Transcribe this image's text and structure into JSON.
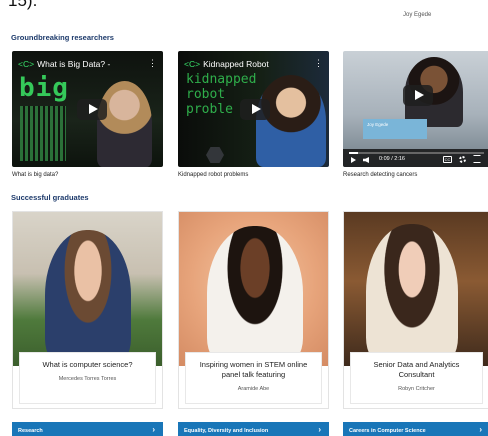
{
  "top": {
    "cut_text": "15).",
    "caption": "Joy Egede"
  },
  "sections": {
    "researchers_title": "Groundbreaking researchers",
    "graduates_title": "Successful graduates"
  },
  "videos": [
    {
      "title_tag": "<C>",
      "title": "What is Big Data? -",
      "caption": "What is big data?",
      "overlay_text": "big"
    },
    {
      "title_tag": "<C>",
      "title": "Kidnapped Robot",
      "caption": "Kidnapped robot problems",
      "overlay_text": "kidnapped robot proble"
    },
    {
      "caption": "Research detecting cancers",
      "badge": "Joy Egede",
      "time": "0:09 / 2:16",
      "progress": 0.07
    }
  ],
  "graduates": [
    {
      "title": "What is computer science?",
      "name": "Mercedes Torres Torres"
    },
    {
      "title": "Inspiring women in STEM online panel talk featuring",
      "name": "Aramide Abe"
    },
    {
      "title": "Senior Data and Analytics Consultant",
      "name": "Robyn Critcher"
    }
  ],
  "ctas": [
    {
      "label": "Research"
    },
    {
      "label": "Equality, Diversity and Inclusion"
    },
    {
      "label": "Careers in Computer Science"
    }
  ],
  "icons": {
    "chevron": "›",
    "menu": "⋮"
  },
  "colors": {
    "accent": "#1976b8",
    "heading": "#1d3a6b",
    "code_green": "#35c95a"
  }
}
